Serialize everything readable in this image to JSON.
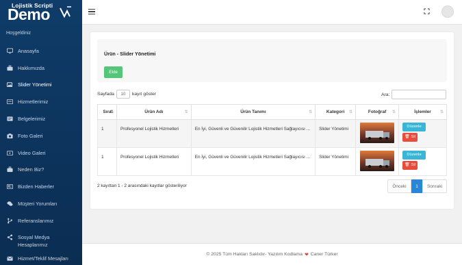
{
  "brand": {
    "small": "Lojistik Scripti",
    "big": "Demo"
  },
  "sidebar": {
    "welcome": "Hoşgeldiniz",
    "items": [
      {
        "label": "Anasayfa",
        "icon": "monitor-icon"
      },
      {
        "label": "Hakkımızda",
        "icon": "briefcase-icon"
      },
      {
        "label": "Slider Yönetimi",
        "icon": "images-icon"
      },
      {
        "label": "Hizmetlerimiz",
        "icon": "tools-icon"
      },
      {
        "label": "Belgelerimiz",
        "icon": "files-icon"
      },
      {
        "label": "Foto Galeri",
        "icon": "camera-icon"
      },
      {
        "label": "Video Galeri",
        "icon": "video-icon"
      },
      {
        "label": "Neden Biz?",
        "icon": "briefcase-icon"
      },
      {
        "label": "Bizden Haberler",
        "icon": "newspaper-icon"
      },
      {
        "label": "Müşteri Yorumları",
        "icon": "comments-icon"
      },
      {
        "label": "Referanslarımız",
        "icon": "branch-icon"
      },
      {
        "label": "Sosyal Medya Hesaplarımız",
        "icon": "share-icon"
      },
      {
        "label": "Hizmet/Teklif Mesajları",
        "icon": "envelope-icon"
      }
    ],
    "active_index": 2
  },
  "card": {
    "title": "Ürün - Slider Yönetimi",
    "add_label": "Ekle",
    "length": {
      "prefix": "Sayfada",
      "value": "10",
      "suffix": "kayıt göster"
    },
    "search_label": "Ara:"
  },
  "table": {
    "columns": [
      "Sıra",
      "Ürün Adı",
      "Ürün Tanımı",
      "Kategori",
      "Fotoğraf",
      "İşlemler"
    ],
    "rows": [
      {
        "sira": "1",
        "ad": "Profesyonel Lojistik Hizmetleri",
        "tanim": "En İyi, Güvenli ve Güvenilir Lojistik Hizmetleri Sağlayıcısı ...",
        "kategori": "Slider Yönetimi",
        "foto": "truck-photo"
      },
      {
        "sira": "1",
        "ad": "Profesyonel Lojistik Hizmetleri",
        "tanim": "En İyi, Güvenli ve Güvenilir Lojistik Hizmetleri Sağlayıcısı ...",
        "kategori": "Slider Yönetimi",
        "foto": "truck-photo"
      }
    ],
    "edit_label": "Düzenle",
    "delete_label": "Sil"
  },
  "info": "2 kayıttan 1 - 2 arasındaki kayıtlar gösteriliyor",
  "pager": {
    "prev": "Önceki",
    "current": "1",
    "next": "Sonraki"
  },
  "footer": {
    "text_before": "© 2025 Tüm Hakları Saklıdır- Yazılım Kodlama",
    "text_after": "Caner Türker"
  },
  "colors": {
    "sidebar": "#0f3c69",
    "add": "#55c679",
    "edit": "#3ab5d6",
    "delete": "#e74c3c",
    "page_active": "#2a86d6"
  }
}
